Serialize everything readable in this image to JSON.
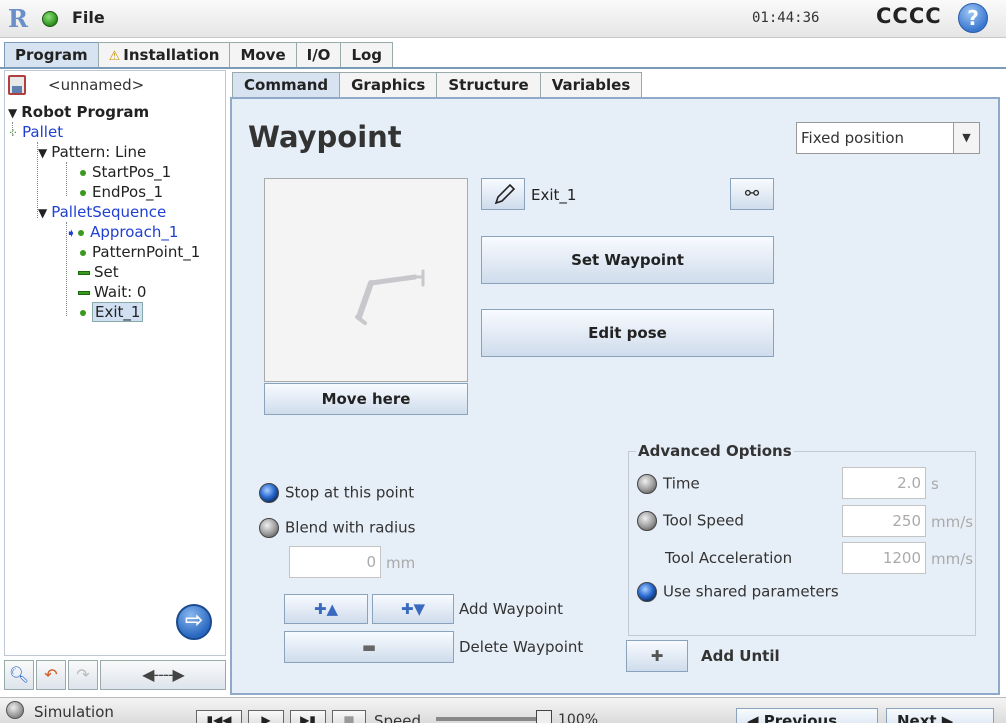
{
  "header": {
    "file_label": "File",
    "clock": "01:44:36",
    "robot_name": "CCCC",
    "help_symbol": "?"
  },
  "main_tabs": [
    {
      "label": "Program",
      "active": true
    },
    {
      "label": "Installation",
      "warning": true
    },
    {
      "label": "Move"
    },
    {
      "label": "I/O"
    },
    {
      "label": "Log"
    }
  ],
  "program": {
    "name": "<unnamed>",
    "tree": [
      {
        "label": "Robot Program"
      },
      {
        "label": "Pallet"
      },
      {
        "label": "Pattern: Line"
      },
      {
        "label": "StartPos_1"
      },
      {
        "label": "EndPos_1"
      },
      {
        "label": "PalletSequence"
      },
      {
        "label": "Approach_1"
      },
      {
        "label": "PatternPoint_1"
      },
      {
        "label": "Set"
      },
      {
        "label": "Wait: 0"
      },
      {
        "label": "Exit_1",
        "selected": true
      }
    ]
  },
  "sub_tabs": [
    {
      "label": "Command",
      "active": true
    },
    {
      "label": "Graphics"
    },
    {
      "label": "Structure"
    },
    {
      "label": "Variables"
    }
  ],
  "waypoint": {
    "title": "Waypoint",
    "position_mode": "Fixed position",
    "name": "Exit_1",
    "set_waypoint_label": "Set Waypoint",
    "edit_pose_label": "Edit pose",
    "move_here_label": "Move here",
    "stop_label": "Stop at this point",
    "blend_label": "Blend with radius",
    "blend_value": "0",
    "blend_unit": "mm",
    "add_waypoint_label": "Add Waypoint",
    "delete_waypoint_label": "Delete Waypoint",
    "add_until_label": "Add Until"
  },
  "advanced": {
    "title": "Advanced Options",
    "time_label": "Time",
    "time_value": "2.0",
    "time_unit": "s",
    "tool_speed_label": "Tool Speed",
    "tool_speed_value": "250",
    "tool_speed_unit": "mm/s",
    "tool_accel_label": "Tool Acceleration",
    "tool_accel_value": "1200",
    "tool_accel_unit": "mm/s",
    "shared_label": "Use shared parameters"
  },
  "footer": {
    "simulation_label": "Simulation",
    "speed_label": "Speed",
    "speed_value": "100%",
    "previous_label": "Previous",
    "next_label": "Next"
  },
  "icons": [
    "logo-icon",
    "status-dot-icon",
    "help-icon",
    "warning-icon",
    "save-icon",
    "pencil-icon",
    "link-icon",
    "add-above-icon",
    "add-below-icon",
    "minus-icon",
    "plus-icon",
    "search-icon",
    "undo-icon",
    "redo-icon",
    "next-circle-icon",
    "simulation-icon"
  ]
}
